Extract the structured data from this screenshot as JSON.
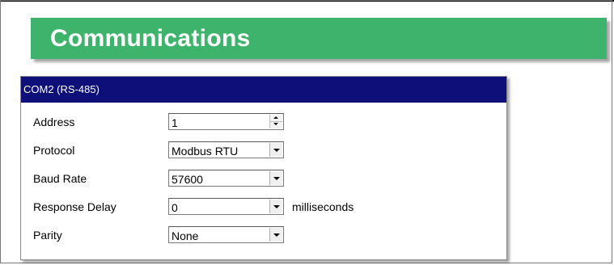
{
  "banner": {
    "title": "Communications",
    "color": "#3db36b"
  },
  "panel": {
    "header": "COM2 (RS-485)",
    "header_color": "#0f0f7a",
    "fields": {
      "address": {
        "label": "Address",
        "value": "1",
        "control": "spinner"
      },
      "protocol": {
        "label": "Protocol",
        "value": "Modbus RTU",
        "control": "dropdown"
      },
      "baud_rate": {
        "label": "Baud Rate",
        "value": "57600",
        "control": "dropdown"
      },
      "response_delay": {
        "label": "Response Delay",
        "value": "0",
        "control": "dropdown",
        "unit": "milliseconds"
      },
      "parity": {
        "label": "Parity",
        "value": "None",
        "control": "dropdown"
      }
    }
  },
  "icons": {
    "spinner": "spin-arrows-icon",
    "dropdown": "chevron-down-icon"
  }
}
